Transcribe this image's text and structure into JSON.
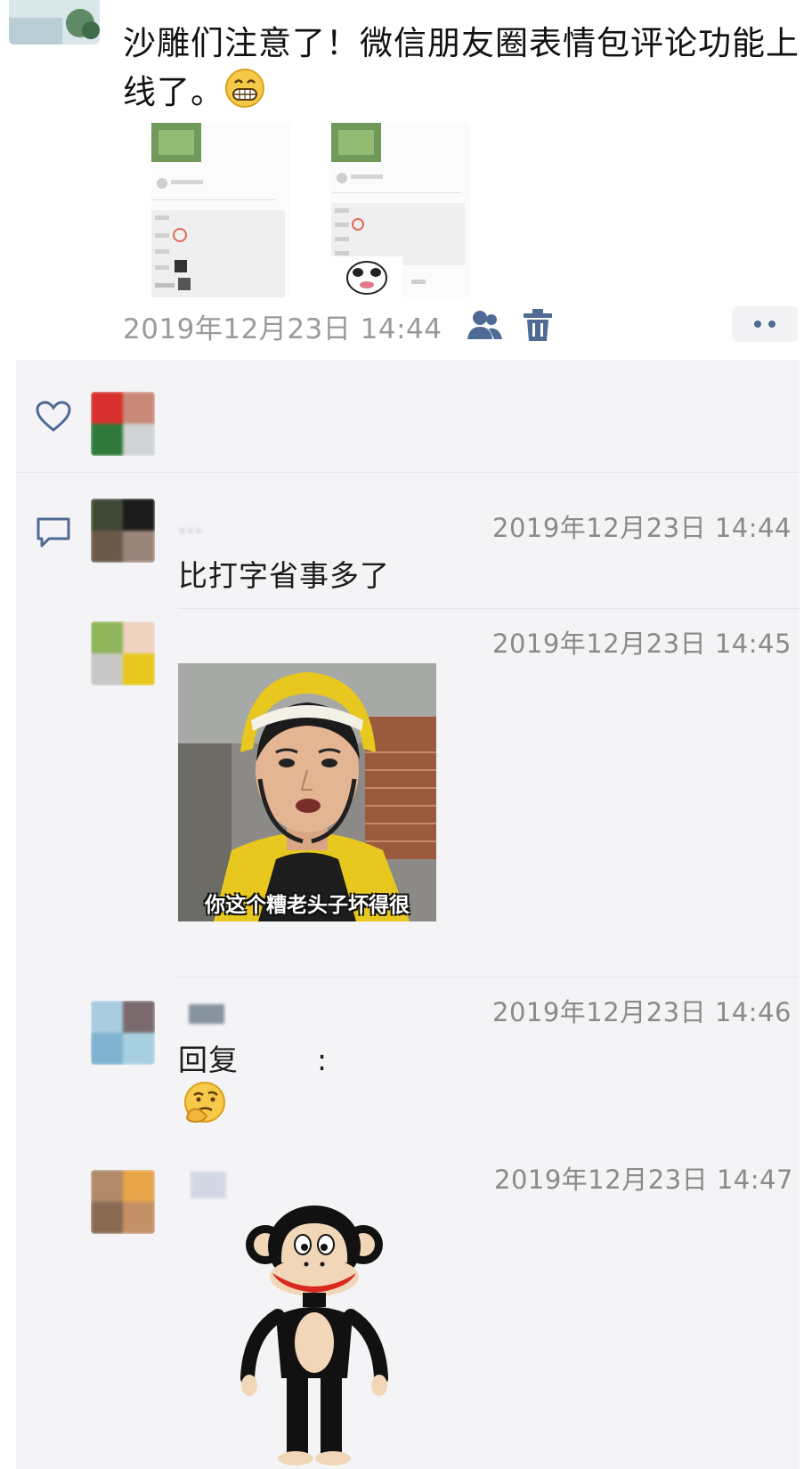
{
  "post": {
    "text": "沙雕们注意了！微信朋友圈表情包评论功能上线了。",
    "time": "2019年12月23日 14:44"
  },
  "comments": [
    {
      "name": "…",
      "time": "2019年12月23日 14:44",
      "text": "比打字省事多了"
    },
    {
      "time": "2019年12月23日 14:45",
      "meme_caption": "你这个糟老头子坏得很"
    },
    {
      "time": "2019年12月23日 14:46",
      "reply_prefix": "回复",
      "reply_suffix": ":"
    },
    {
      "time": "2019年12月23日 14:47"
    }
  ],
  "colors": {
    "panel_bg": "#f4f4f6",
    "link_blue": "#4f6a95",
    "time_gray": "#9a9a9a"
  },
  "icons": [
    "friends-icon",
    "trash-icon",
    "heart-icon",
    "comment-icon",
    "grin-emoji",
    "thinking-emoji"
  ]
}
